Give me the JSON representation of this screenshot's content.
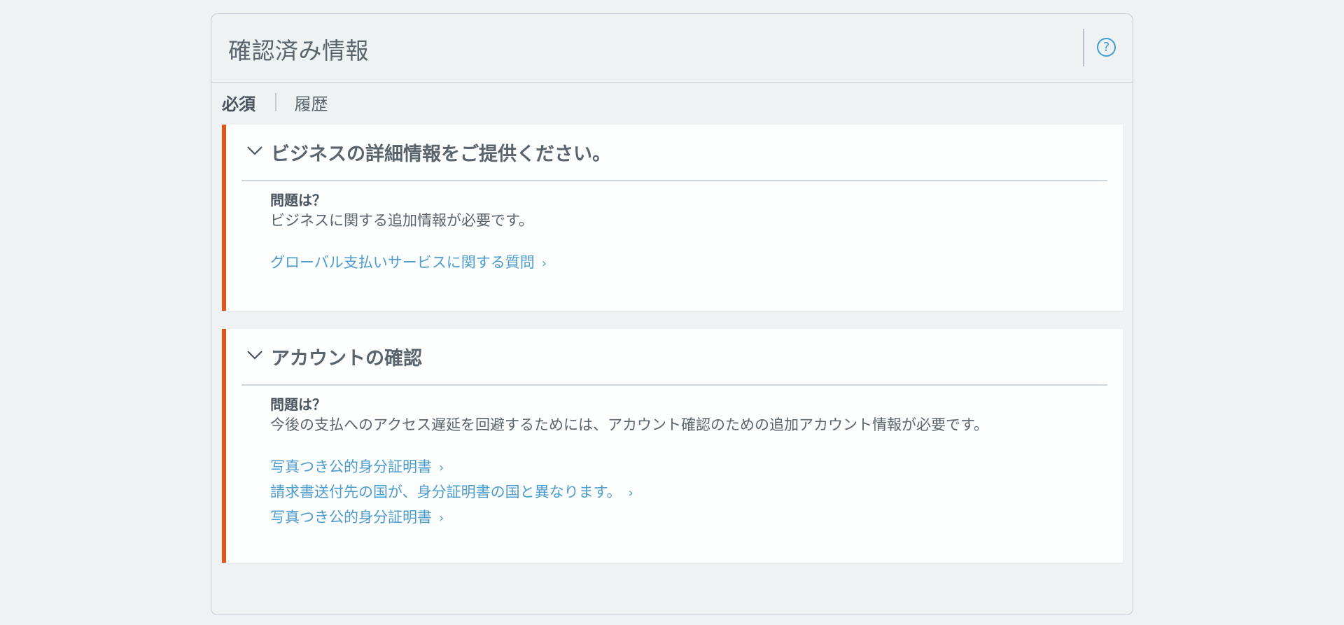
{
  "header": {
    "title": "確認済み情報",
    "help_icon": "?"
  },
  "tabs": [
    {
      "label": "必須",
      "active": true
    },
    {
      "label": "履歴",
      "active": false
    }
  ],
  "cards": [
    {
      "title": "ビジネスの詳細情報をご提供ください。",
      "question_label": "問題は？",
      "question_text": "ビジネスに関する追加情報が必要です。",
      "links": [
        {
          "label": "グローバル支払いサービスに関する質問",
          "arrow": "›"
        }
      ]
    },
    {
      "title": "アカウントの確認",
      "question_label": "問題は？",
      "question_text": "今後の支払へのアクセス遅延を回避するためには、アカウント確認のための追加アカウント情報が必要です。",
      "links": [
        {
          "label": "写真つき公的身分証明書",
          "arrow": "›"
        },
        {
          "label": "請求書送付先の国が、身分証明書の国と異なります。",
          "arrow": "›"
        },
        {
          "label": "写真つき公的身分証明書",
          "arrow": "›"
        }
      ]
    }
  ],
  "colors": {
    "accent": "#e2541a",
    "link": "#4d9ccd",
    "help": "#3f9ed3"
  }
}
